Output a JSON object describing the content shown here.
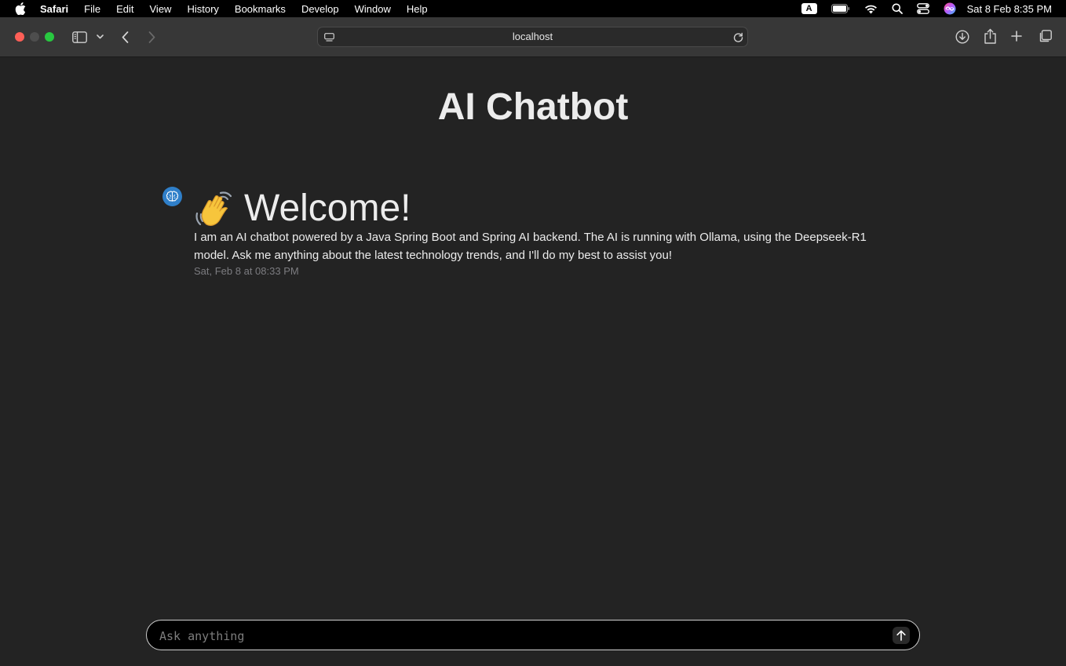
{
  "menubar": {
    "app_name": "Safari",
    "items": [
      "File",
      "Edit",
      "View",
      "History",
      "Bookmarks",
      "Develop",
      "Window",
      "Help"
    ],
    "input_source": "A",
    "clock": "Sat 8 Feb  8:35 PM"
  },
  "toolbar": {
    "url": "localhost",
    "traffic_colors": {
      "close": "#fe5f57",
      "minimize": "#4e4e4e",
      "zoom": "#28c840"
    }
  },
  "page": {
    "title": "AI Chatbot"
  },
  "message": {
    "heading_emoji": "👋",
    "heading": "Welcome!",
    "body": "I am an AI chatbot powered by a Java Spring Boot and Spring AI backend. The AI is running with Ollama, using the Deepseek-R1 model. Ask me anything about the latest technology trends, and I'll do my best to assist you!",
    "timestamp": "Sat, Feb 8 at 08:33 PM",
    "avatar_icon": "brain-icon",
    "avatar_color": "#2f7fc9"
  },
  "chat_input": {
    "placeholder": "Ask anything",
    "value": ""
  }
}
